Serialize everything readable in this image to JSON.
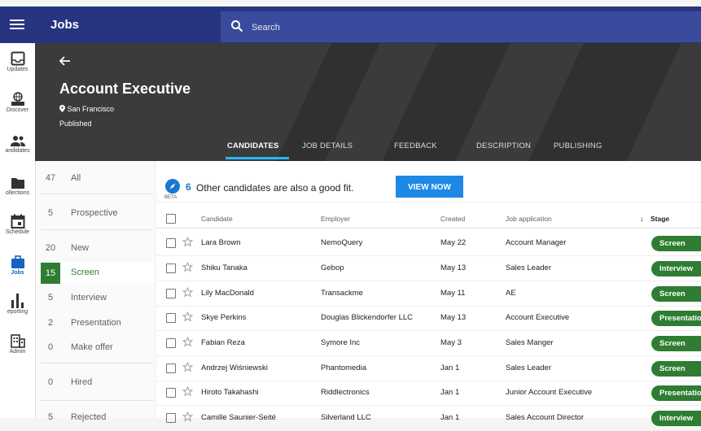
{
  "app": {
    "title": "Jobs"
  },
  "search": {
    "placeholder": "Search"
  },
  "nav": [
    {
      "label": "Updates",
      "icon": "inbox-icon"
    },
    {
      "label": "Discover",
      "icon": "globe-beta-icon"
    },
    {
      "label": "andidates",
      "icon": "people-icon"
    },
    {
      "label": "ollections",
      "icon": "folder-icon"
    },
    {
      "label": "Schedule",
      "icon": "calendar-icon"
    },
    {
      "label": "Jobs",
      "icon": "briefcase-icon",
      "active": true
    },
    {
      "label": "eporting",
      "icon": "bar-chart-icon"
    },
    {
      "label": "Admin",
      "icon": "building-icon"
    }
  ],
  "job": {
    "title": "Account Executive",
    "location": "San Francisco",
    "status": "Published"
  },
  "tabs": [
    "CANDIDATES",
    "JOB DETAILS",
    "FEEDBACK",
    "DESCRIPTION",
    "PUBLISHING"
  ],
  "stages": [
    {
      "count": "47",
      "name": "All"
    },
    {
      "count": "5",
      "name": "Prospective"
    },
    {
      "count": "20",
      "name": "New"
    },
    {
      "count": "15",
      "name": "Screen",
      "active": true
    },
    {
      "count": "5",
      "name": "Interview"
    },
    {
      "count": "2",
      "name": "Presentation"
    },
    {
      "count": "0",
      "name": "Make offer"
    },
    {
      "count": "0",
      "name": "Hired"
    },
    {
      "count": "5",
      "name": "Rejected"
    }
  ],
  "banner": {
    "beta": "BETA",
    "count": "6",
    "text": "Other candidates are also a good fit.",
    "button": "VIEW NOW"
  },
  "table": {
    "headers": {
      "candidate": "Candidate",
      "employer": "Employer",
      "created": "Created",
      "job_application": "Job application",
      "stage": "Stage",
      "sort_indicator": "↓"
    },
    "rows": [
      {
        "name": "Lara Brown",
        "employer": "NemoQuery",
        "created": "May 22",
        "application": "Account Manager",
        "stage": "Screen"
      },
      {
        "name": "Shiku Tanaka",
        "employer": "Gebop",
        "created": "May 13",
        "application": "Sales Leader",
        "stage": "Interview"
      },
      {
        "name": "Lily MacDonald",
        "employer": "Transackme",
        "created": "May 11",
        "application": "AE",
        "stage": "Screen"
      },
      {
        "name": "Skye Perkins",
        "employer": "Douglas Blickendorfer LLC",
        "created": "May 13",
        "application": "Account Executive",
        "stage": "Presentation"
      },
      {
        "name": "Fabian Reza",
        "employer": "Symore Inc",
        "created": "May 3",
        "application": "Sales Manger",
        "stage": "Screen"
      },
      {
        "name": "Andrzej Wiśniewski",
        "employer": "Phantomedia",
        "created": "Jan 1",
        "application": "Sales Leader",
        "stage": "Screen"
      },
      {
        "name": "Hiroto Takahashi",
        "employer": "Riddlectronics",
        "created": "Jan 1",
        "application": "Junior Account Executive",
        "stage": "Presentation"
      },
      {
        "name": "Camille Saunier-Seité",
        "employer": "Silverland LLC",
        "created": "Jan 1",
        "application": "Sales Account Director",
        "stage": "Interview"
      }
    ]
  },
  "colors": {
    "topbar": "#273480",
    "search": "#3a4a9c",
    "accent_green": "#2e7d32",
    "accent_blue": "#1e88e5",
    "header": "#3b3b3b"
  }
}
